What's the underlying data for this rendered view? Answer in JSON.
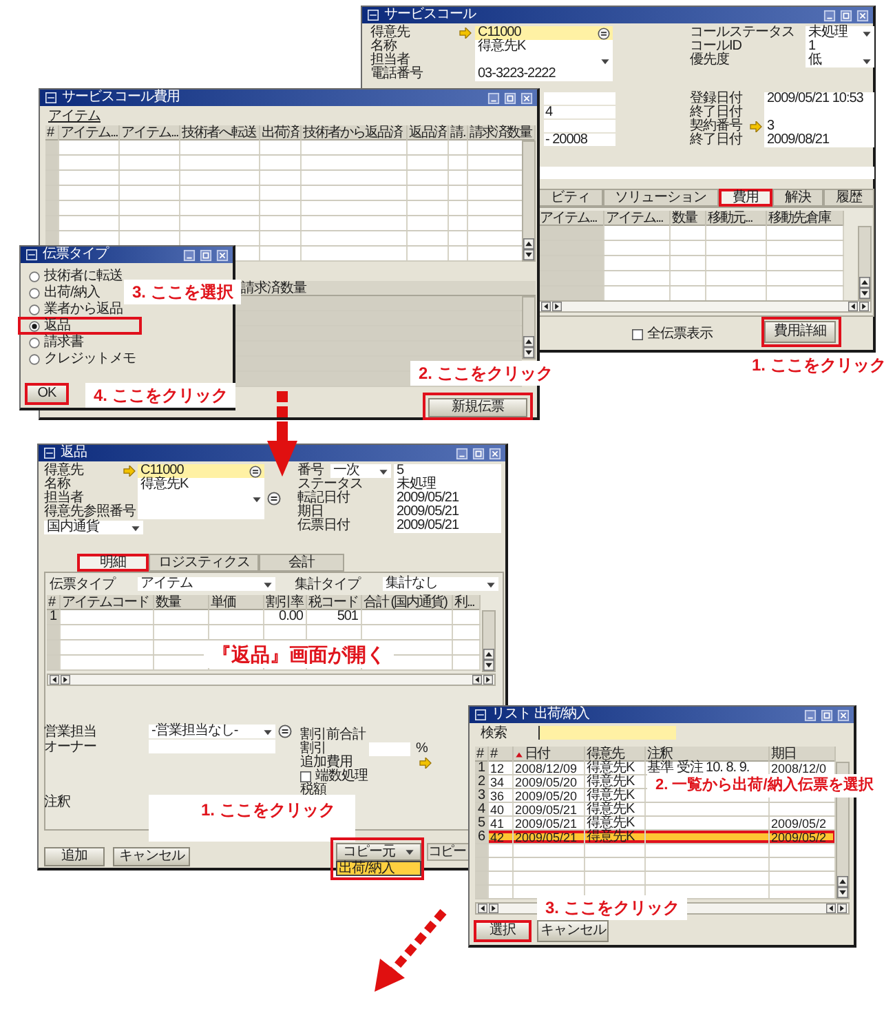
{
  "service_call": {
    "title": "サービスコール",
    "fields": [
      {
        "kind": "lookup",
        "label": "得意先",
        "value": "C11000"
      },
      {
        "kind": "text",
        "label": "名称",
        "value": "得意先K"
      },
      {
        "kind": "dropdown",
        "label": "担当者"
      },
      {
        "kind": "text",
        "label": "電話番号",
        "value": "03-3223-2222"
      }
    ],
    "status_fields": [
      {
        "kind": "dropdown",
        "label": "コールステータス",
        "value": "未処理"
      },
      {
        "kind": "text",
        "label": "コールID",
        "value": "1"
      },
      {
        "kind": "dropdown",
        "label": "優先度",
        "value": "低"
      }
    ],
    "partial_fields": [
      "4",
      "- 20008"
    ],
    "date_fields": [
      {
        "kind": "text",
        "label": "登録日付",
        "value": "2009/05/21 10:53"
      },
      {
        "kind": "text",
        "label": "終了日付"
      },
      {
        "kind": "link",
        "label": "契約番号",
        "value": "3"
      },
      {
        "kind": "text",
        "label": "終了日付",
        "value": "2009/08/21"
      }
    ],
    "tabs": [
      {
        "label": "ビティ",
        "selected": false
      },
      {
        "label": "ソリューション",
        "selected": false
      },
      {
        "label": "費用",
        "selected": true
      },
      {
        "label": "解決",
        "selected": false
      },
      {
        "label": "履歴",
        "selected": false
      }
    ],
    "columns": [
      "アイテム...",
      "アイテム...",
      "数量",
      "移動元...",
      "移動先倉庫"
    ],
    "show_all": {
      "label": "全伝票表示",
      "checked": false
    },
    "button": "費用詳細"
  },
  "costs_window": {
    "title": "サービスコール費用",
    "section": "アイテム",
    "columns": [
      "#",
      "アイテム...",
      "アイテム...",
      "技術者へ転送",
      "出荷済",
      "技術者から返品済",
      "返品済",
      "請.",
      "請求済数量"
    ],
    "lower_column": "請求済数量",
    "button": "新規伝票"
  },
  "doc_type_dialog": {
    "title": "伝票タイプ",
    "options": [
      {
        "label": "技術者に転送",
        "selected": false
      },
      {
        "label": "出荷/納入",
        "selected": false
      },
      {
        "label": "業者から返品",
        "selected": false
      },
      {
        "label": "返品",
        "selected": true
      },
      {
        "label": "請求書",
        "selected": false
      },
      {
        "label": "クレジットメモ",
        "selected": false
      }
    ],
    "button": "OK"
  },
  "returns_window": {
    "title": "返品",
    "fields": [
      {
        "kind": "lookup",
        "label": "得意先",
        "value": "C11000"
      },
      {
        "kind": "text",
        "label": "名称",
        "value": "得意先K"
      },
      {
        "kind": "dropdown",
        "label": "担当者"
      },
      {
        "kind": "text",
        "label": "得意先参照番号"
      }
    ],
    "currency": "国内通貨",
    "number": {
      "label": "番号",
      "series": "一次",
      "value": "5"
    },
    "header_fields": [
      {
        "label": "ステータス",
        "value": "未処理"
      },
      {
        "label": "転記日付",
        "value": "2009/05/21"
      },
      {
        "label": "期日",
        "value": "2009/05/21"
      },
      {
        "label": "伝票日付",
        "value": "2009/05/21"
      }
    ],
    "tabs": [
      {
        "label": "明細",
        "selected": true
      },
      {
        "label": "ロジスティクス",
        "selected": false
      },
      {
        "label": "会計",
        "selected": false
      }
    ],
    "doc_type": {
      "label": "伝票タイプ",
      "value": "アイテム"
    },
    "summary_type": {
      "label": "集計タイプ",
      "value": "集計なし"
    },
    "columns": [
      "#",
      "アイテムコード",
      "数量",
      "単価",
      "割引率",
      "税コード",
      "合計 (国内通貨)",
      "利..."
    ],
    "rows": [
      {
        "index": "1",
        "discount": "0.00",
        "tax_code": "501"
      }
    ],
    "sales_employee": {
      "label": "営業担当",
      "value": "-営業担当なし-"
    },
    "owner": {
      "label": "オーナー"
    },
    "totals": [
      {
        "kind": "text",
        "label": "割引前合計"
      },
      {
        "kind": "percent",
        "label": "割引",
        "unit": "%"
      },
      {
        "kind": "link",
        "label": "追加費用"
      },
      {
        "kind": "checkbox",
        "label": "端数処理",
        "checked": false
      },
      {
        "kind": "text",
        "label": "税額"
      }
    ],
    "remarks": {
      "label": "注釈"
    },
    "buttons": [
      "追加",
      "キャンセル"
    ],
    "copy_from": "コピー元",
    "copy_to": "コピー",
    "copy_menu": [
      "出荷/納入"
    ]
  },
  "list_window": {
    "title": "リスト 出荷/納入",
    "search": {
      "label": "検索"
    },
    "columns": [
      "#",
      "#",
      "日付",
      "得意先",
      "注釈",
      "期日"
    ],
    "rows": [
      {
        "index": "1",
        "number": "12",
        "date": "2008/12/09",
        "customer": "得意先K",
        "remarks": "基準 受注 10. 8. 9.",
        "due": "2008/12/0",
        "selected": false
      },
      {
        "index": "2",
        "number": "34",
        "date": "2009/05/20",
        "customer": "得意先K",
        "selected": false
      },
      {
        "index": "3",
        "number": "36",
        "date": "2009/05/20",
        "customer": "得意先K",
        "selected": false
      },
      {
        "index": "4",
        "number": "40",
        "date": "2009/05/21",
        "customer": "得意先K",
        "selected": false
      },
      {
        "index": "5",
        "number": "41",
        "date": "2009/05/21",
        "customer": "得意先K",
        "due": "2009/05/2",
        "selected": false
      },
      {
        "index": "6",
        "number": "42",
        "date": "2009/05/21",
        "customer": "得意先K",
        "due": "2009/05/2",
        "selected": true
      }
    ],
    "buttons": [
      "選択",
      "キャンセル"
    ]
  },
  "annotations": [
    "1. ここをクリック",
    "2. ここをクリック",
    "3. ここを選択",
    "4. ここをクリック",
    "『返品』画面が開く",
    "1. ここをクリック",
    "2. 一覧から出荷/納入伝票を選択",
    "3. ここをクリック"
  ]
}
